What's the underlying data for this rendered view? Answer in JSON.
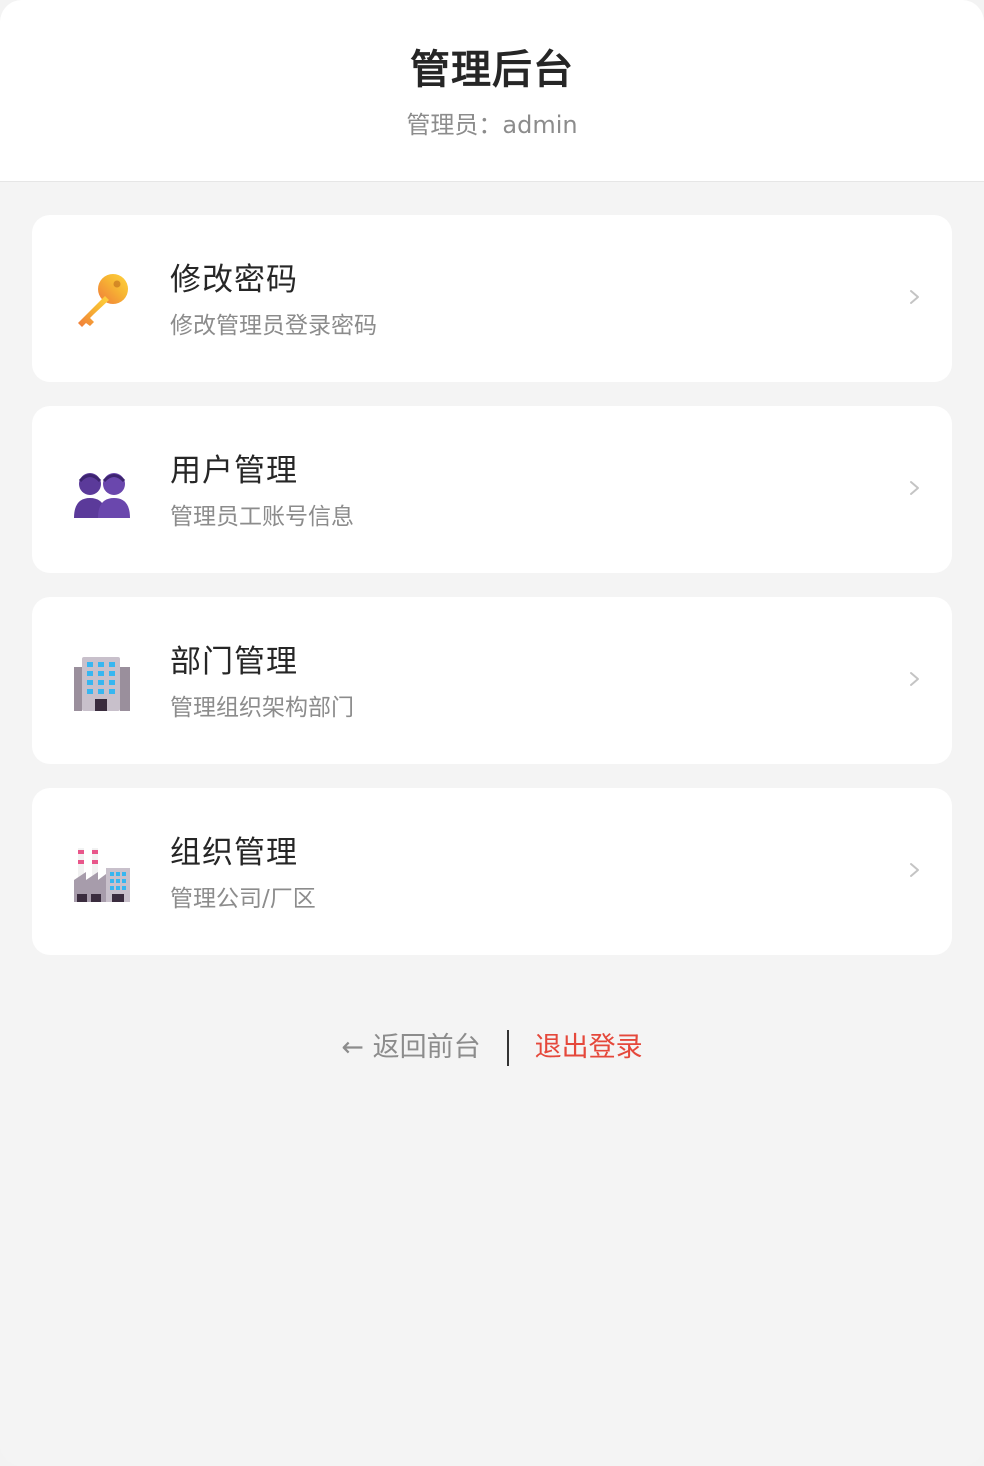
{
  "header": {
    "title": "管理后台",
    "subtitle": "管理员：admin"
  },
  "menu": [
    {
      "title": "修改密码",
      "desc": "修改管理员登录密码",
      "icon": "key-icon"
    },
    {
      "title": "用户管理",
      "desc": "管理员工账号信息",
      "icon": "users-icon"
    },
    {
      "title": "部门管理",
      "desc": "管理组织架构部门",
      "icon": "office-building-icon"
    },
    {
      "title": "组织管理",
      "desc": "管理公司/厂区",
      "icon": "factory-icon"
    }
  ],
  "footer": {
    "back_label": "← 返回前台",
    "logout_label": "退出登录"
  },
  "colors": {
    "background": "#f4f4f4",
    "card": "#ffffff",
    "title": "#262626",
    "muted": "#8c8c8c",
    "danger": "#e5483b"
  }
}
